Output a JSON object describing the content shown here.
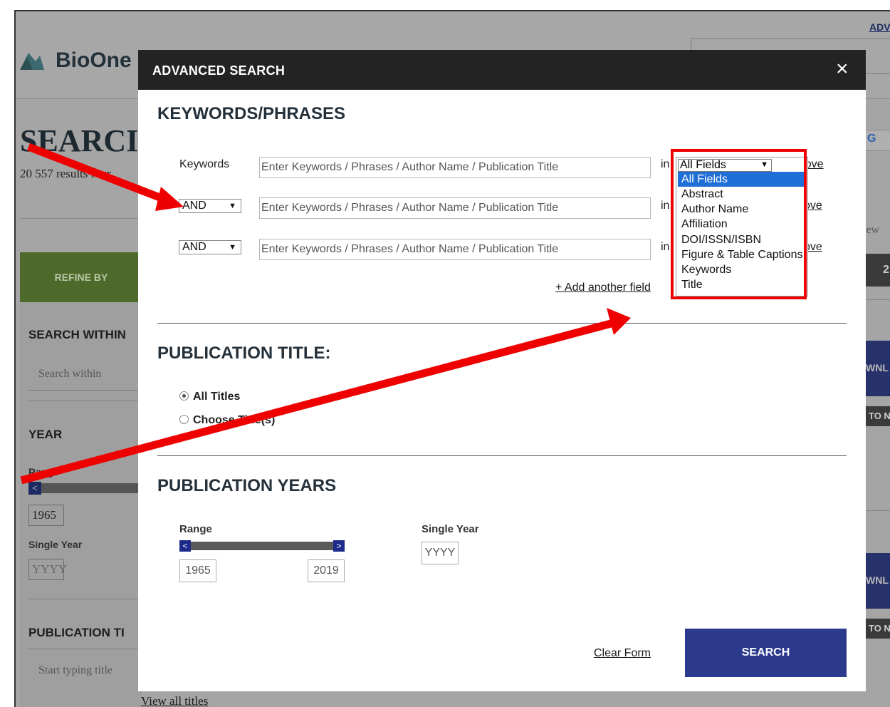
{
  "background_page": {
    "header_link": "ADV",
    "logo_text": "BioOne",
    "title": "SEARCI",
    "results_count": "20 557 results four",
    "refine_label": "REFINE BY",
    "search_within_heading": "SEARCH WITHIN",
    "search_within_placeholder": "Search within",
    "year_heading": "YEAR",
    "range_label": "Range",
    "range_handle": "<",
    "range_start": "1965",
    "single_year_label": "Single Year",
    "single_year_placeholder": "YYYY",
    "publication_title_heading": "PUBLICATION TI",
    "publication_title_placeholder": "Start typing title",
    "view_all_titles": "View all titles",
    "right_g_label": "G",
    "right_view": "iew",
    "right_dark_label": "2",
    "right_download_1": "WNL",
    "right_to_1": "TO N",
    "right_download_2": "WNL",
    "right_to_2": "TO N"
  },
  "modal": {
    "title": "ADVANCED SEARCH",
    "close_glyph": "×",
    "keywords_section_title": "KEYWORDS/PHRASES",
    "keywords_label": "Keywords",
    "rows": [
      {
        "operator": "",
        "placeholder": "Enter Keywords / Phrases / Author Name / Publication Title",
        "in": "in",
        "remove": "Remove"
      },
      {
        "operator": "AND",
        "placeholder": "Enter Keywords / Phrases / Author Name / Publication Title",
        "in": "in",
        "remove": "ove"
      },
      {
        "operator": "AND",
        "placeholder": "Enter Keywords / Phrases / Author Name / Publication Title",
        "in": "in",
        "remove": "ove"
      }
    ],
    "field_select": {
      "selected": "All Fields",
      "options": [
        "All Fields",
        "Abstract",
        "Author Name",
        "Affiliation",
        "DOI/ISSN/ISBN",
        "Figure & Table Captions",
        "Keywords",
        "Title"
      ]
    },
    "add_field": "+ Add another field",
    "publication_title_section": "PUBLICATION TITLE:",
    "radio_all_titles": "All Titles",
    "radio_choose_titles": "Choose Title(s)",
    "publication_years_section": "PUBLICATION YEARS",
    "range_label": "Range",
    "range_left_handle": "<",
    "range_right_handle": ">",
    "range_start": "1965",
    "range_end": "2019",
    "single_year_label": "Single Year",
    "single_year_placeholder": "YYYY",
    "clear_form": "Clear Form",
    "search_button": "SEARCH"
  },
  "annotations": {
    "highlight_color": "#ee0000",
    "arrow_color": "#ee0000"
  }
}
